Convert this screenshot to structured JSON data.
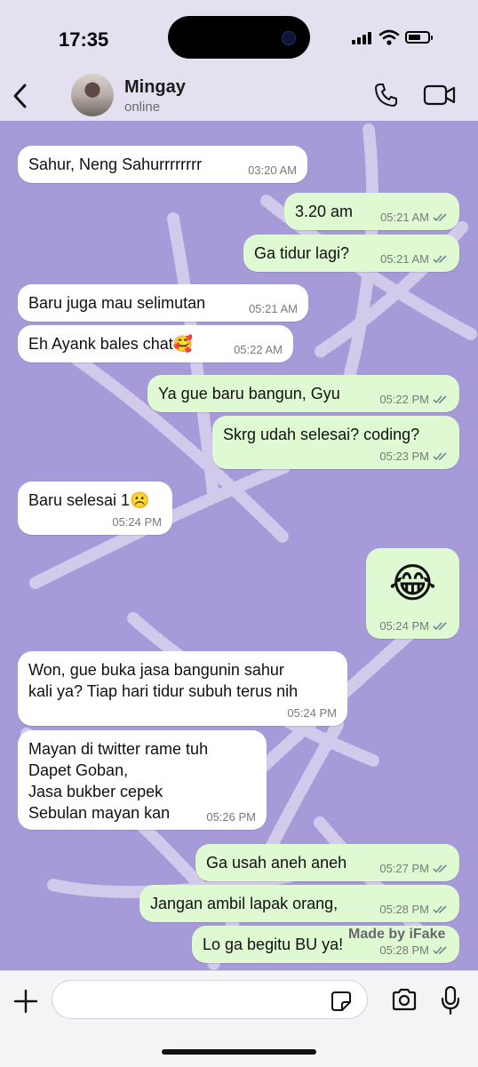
{
  "status": {
    "time": "17:35"
  },
  "header": {
    "name": "Mingay",
    "presence": "online"
  },
  "messages": [
    {
      "dir": "in",
      "text": "Sahur, Neng Sahurrrrrrrr",
      "time": "03:20 AM"
    },
    {
      "dir": "out",
      "text": "3.20 am",
      "time": "05:21 AM"
    },
    {
      "dir": "out",
      "text": "Ga tidur lagi?",
      "time": "05:21 AM"
    },
    {
      "dir": "in",
      "text": "Baru juga mau selimutan",
      "time": "05:21 AM"
    },
    {
      "dir": "in",
      "text": "Eh Ayank bales chat🥰",
      "time": "05:22 AM"
    },
    {
      "dir": "out",
      "text": "Ya gue baru bangun, Gyu",
      "time": "05:22 PM"
    },
    {
      "dir": "out",
      "text": "Skrg udah selesai? coding?",
      "time": "05:23 PM"
    },
    {
      "dir": "in",
      "text": "Baru selesai 1☹️",
      "time": "05:24 PM"
    },
    {
      "dir": "out",
      "text": "😂",
      "time": "05:24 PM"
    },
    {
      "dir": "in",
      "text": "Won, gue buka jasa bangunin sahur\nkali ya? Tiap hari tidur subuh terus nih",
      "time": "05:24 PM"
    },
    {
      "dir": "in",
      "text": "Mayan di twitter rame tuh\nDapet Goban,\nJasa bukber cepek\nSebulan mayan kan",
      "time": "05:26 PM"
    },
    {
      "dir": "out",
      "text": "Ga usah aneh aneh",
      "time": "05:27 PM"
    },
    {
      "dir": "out",
      "text": "Jangan ambil lapak orang,",
      "time": "05:28 PM"
    },
    {
      "dir": "out",
      "text": "Lo ga begitu BU ya!",
      "time": "05:28 PM"
    }
  ],
  "watermark": "Made by iFake",
  "composer": {
    "placeholder": ""
  },
  "colors": {
    "wallpaper": "#a79ad8",
    "incoming": "#ffffff",
    "outgoing": "#dff9d2",
    "header": "#e4e0f0",
    "read_ticks": "#6f8a8f"
  },
  "icons": [
    "back-chevron-icon",
    "phone-icon",
    "video-camera-icon",
    "plus-icon",
    "sticker-icon",
    "camera-icon",
    "microphone-icon"
  ]
}
